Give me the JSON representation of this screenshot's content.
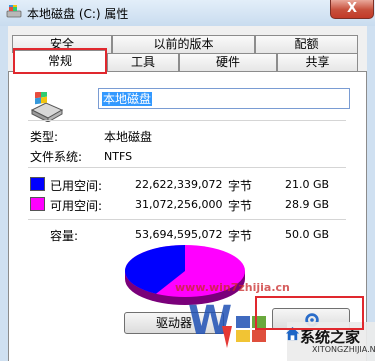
{
  "window": {
    "title": "本地磁盘 (C:) 属性",
    "close_label": "X"
  },
  "tabs": {
    "row1": [
      {
        "label": "安全"
      },
      {
        "label": "以前的版本"
      },
      {
        "label": "配额"
      }
    ],
    "row2": [
      {
        "label": "常规",
        "active": true
      },
      {
        "label": "工具"
      },
      {
        "label": "硬件"
      },
      {
        "label": "共享"
      }
    ]
  },
  "general": {
    "drive_name": "本地磁盘",
    "type_label": "类型:",
    "type_value": "本地磁盘",
    "fs_label": "文件系统:",
    "fs_value": "NTFS",
    "used": {
      "label": "已用空间:",
      "bytes": "22,622,339,072",
      "unit": "字节",
      "size": "21.0 GB",
      "color": "#0000ff"
    },
    "free": {
      "label": "可用空间:",
      "bytes": "31,072,256,000",
      "unit": "字节",
      "size": "28.9 GB",
      "color": "#ff00ff"
    },
    "capacity": {
      "label": "容量:",
      "bytes": "53,694,595,072",
      "unit": "字节",
      "size": "50.0 GB"
    },
    "used_fraction": 0.42,
    "drive_button_label": "驱动器"
  },
  "watermark": {
    "url": "www.win7zhijia.cn",
    "brand": "系统之家",
    "brand_sub": "XITONGZHIJIA.NET"
  },
  "icons": {
    "window": "drive-icon",
    "drive": "hard-drive-icon",
    "gear": "gear-icon"
  }
}
